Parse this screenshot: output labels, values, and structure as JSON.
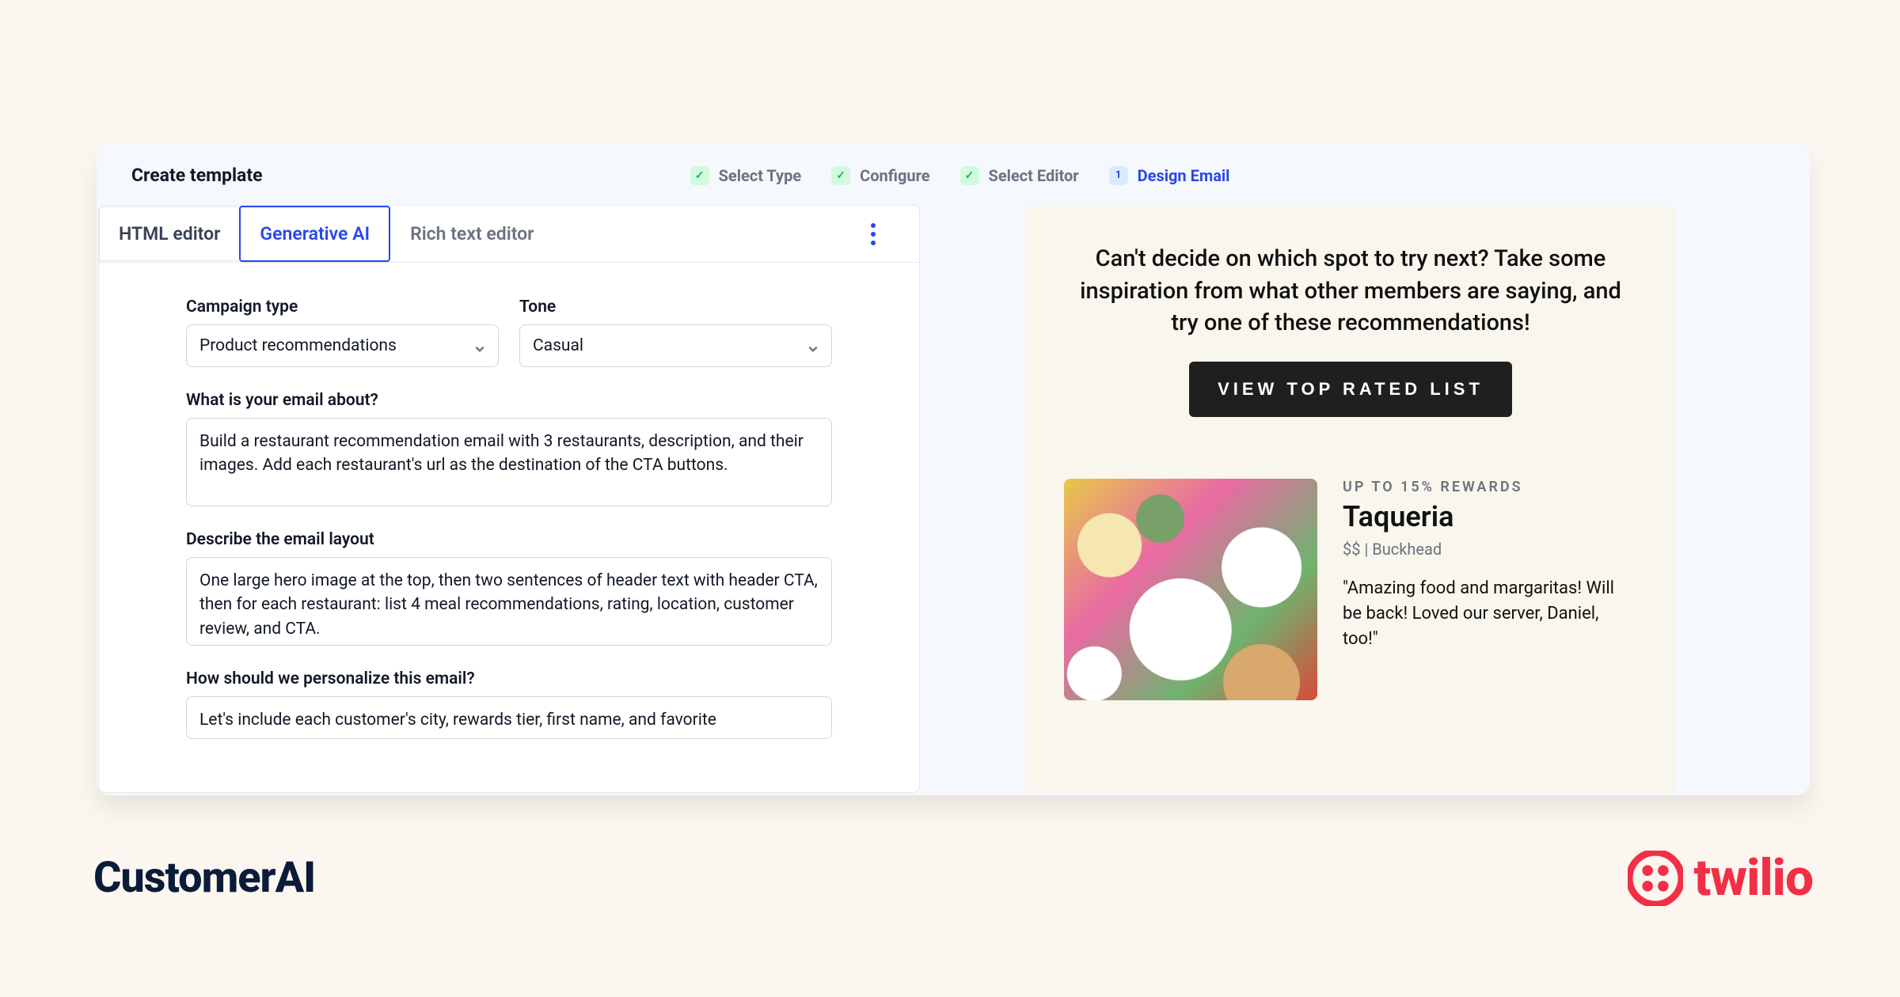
{
  "header": {
    "title": "Create template"
  },
  "stepper": {
    "steps": [
      {
        "label": "Select Type",
        "done": true
      },
      {
        "label": "Configure",
        "done": true
      },
      {
        "label": "Select Editor",
        "done": true
      },
      {
        "label": "Design Email",
        "active": true,
        "number": "1"
      }
    ]
  },
  "tabs": {
    "items": [
      "HTML editor",
      "Generative AI",
      "Rich text editor"
    ],
    "active_index": 1
  },
  "form": {
    "campaign_type": {
      "label": "Campaign type",
      "value": "Product recommendations"
    },
    "tone": {
      "label": "Tone",
      "value": "Casual"
    },
    "about": {
      "label": "What is your email about?",
      "value": "Build a restaurant recommendation email with 3 restaurants, description, and their images. Add each restaurant's url as the destination of the CTA buttons."
    },
    "layout": {
      "label": "Describe the email layout",
      "value": "One large hero image at the top, then two sentences of header text with header CTA, then for each restaurant: list 4 meal recommendations, rating, location, customer review, and CTA."
    },
    "personalize": {
      "label": "How should we personalize this email?",
      "value": "Let's include each customer's city, rewards tier, first name, and favorite"
    }
  },
  "preview": {
    "hero_text": "Can't decide on which spot to try next? Take some inspiration from what other members are saying, and try one of these recommendations!",
    "hero_cta": "VIEW TOP RATED LIST",
    "card": {
      "eyebrow": "UP TO 15% REWARDS",
      "title": "Taqueria",
      "price": "$$",
      "sep": " | ",
      "location": "Buckhead",
      "quote": "\"Amazing food and margaritas! Will be back! Loved our server, Daniel, too!\""
    }
  },
  "footer": {
    "product": "CustomerAI",
    "brand": "twilio"
  }
}
